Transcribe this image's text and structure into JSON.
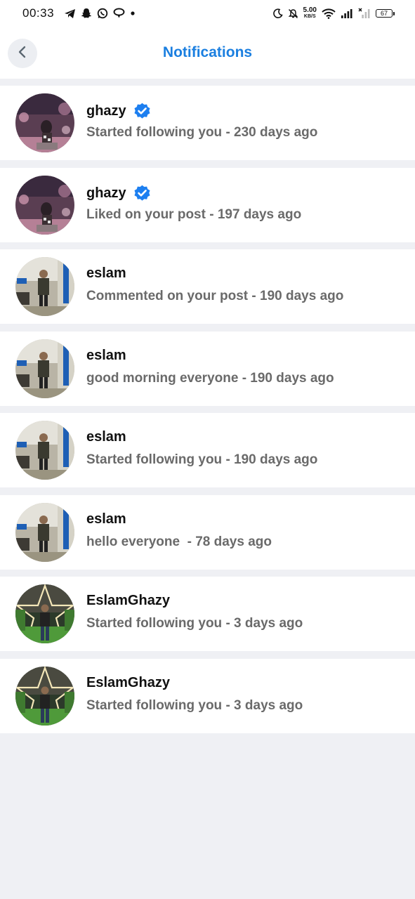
{
  "status_bar": {
    "time": "00:33",
    "left_icons": [
      "telegram-icon",
      "snapchat-icon",
      "whatsapp-icon",
      "chat-bubble-icon",
      "dot-icon"
    ],
    "net_speed_value": "5.00",
    "net_speed_unit": "KB/S",
    "battery": "67"
  },
  "header": {
    "title": "Notifications",
    "accent_color": "#1b7fe0"
  },
  "notifications": [
    {
      "name": "ghazy",
      "verified": true,
      "text": "Started following you - 230 days ago",
      "avatar": "groot"
    },
    {
      "name": "ghazy",
      "verified": true,
      "text": "Liked on your post - 197 days ago",
      "avatar": "groot"
    },
    {
      "name": "eslam",
      "verified": false,
      "text": "Commented on your post - 190 days ago",
      "avatar": "office"
    },
    {
      "name": "eslam",
      "verified": false,
      "text": "good morning everyone - 190 days ago",
      "avatar": "office"
    },
    {
      "name": "eslam",
      "verified": false,
      "text": "Started following you - 190 days ago",
      "avatar": "office"
    },
    {
      "name": "eslam",
      "verified": false,
      "text": "hello everyone  - 78 days ago",
      "avatar": "office"
    },
    {
      "name": "EslamGhazy",
      "verified": false,
      "text": "Started following you - 3 days ago",
      "avatar": "star"
    },
    {
      "name": "EslamGhazy",
      "verified": false,
      "text": "Started following you - 3 days ago",
      "avatar": "star"
    }
  ]
}
